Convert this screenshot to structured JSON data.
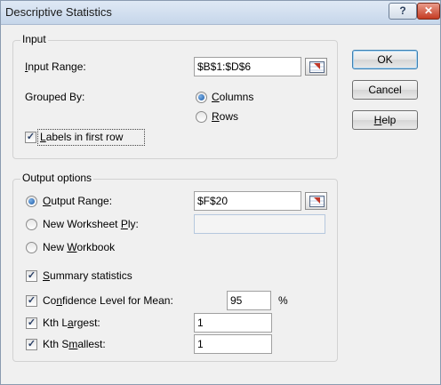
{
  "window": {
    "title": "Descriptive Statistics",
    "help_glyph": "?",
    "close_glyph": "✕"
  },
  "input_group": {
    "label": "Input",
    "input_range": {
      "prefix": "",
      "accel": "I",
      "rest": "nput Range:",
      "value": "$B$1:$D$6"
    },
    "grouped_by": {
      "label": "Grouped By:",
      "columns": {
        "accel": "C",
        "rest": "olumns",
        "selected": true
      },
      "rows": {
        "accel": "R",
        "rest": "ows",
        "selected": false
      }
    },
    "labels_first_row": {
      "accel": "L",
      "rest": "abels in first row",
      "checked": true
    }
  },
  "output_group": {
    "label": "Output options",
    "output_range": {
      "accel": "O",
      "rest": "utput Range:",
      "value": "$F$20",
      "selected": true
    },
    "new_worksheet": {
      "prefix": "New Worksheet ",
      "accel": "P",
      "rest": "ly:",
      "value": "",
      "selected": false
    },
    "new_workbook": {
      "prefix": "New ",
      "accel": "W",
      "rest": "orkbook",
      "selected": false
    },
    "summary_statistics": {
      "accel": "S",
      "rest": "ummary statistics",
      "checked": true
    },
    "confidence_level": {
      "prefix": "Co",
      "accel": "n",
      "rest": "fidence Level for Mean:",
      "value": "95",
      "unit": "%",
      "checked": true
    },
    "kth_largest": {
      "prefix": "Kth L",
      "accel": "a",
      "rest": "rgest:",
      "value": "1",
      "checked": true
    },
    "kth_smallest": {
      "prefix": "Kth S",
      "accel": "m",
      "rest": "allest:",
      "value": "1",
      "checked": true
    }
  },
  "buttons": {
    "ok": "OK",
    "cancel": "Cancel",
    "help": {
      "accel": "H",
      "rest": "elp"
    }
  },
  "check_glyph": "✓"
}
